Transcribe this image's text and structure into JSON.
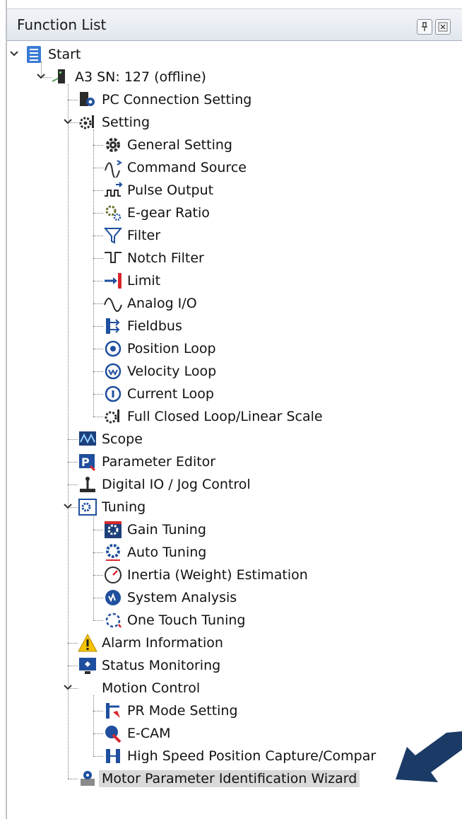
{
  "panel": {
    "title": "Function List"
  },
  "tree": {
    "root": "Start",
    "device": "A3 SN: 127 (offline)",
    "pc_connection": "PC Connection Setting",
    "setting": {
      "label": "Setting",
      "items": [
        "General Setting",
        "Command Source",
        "Pulse Output",
        "E-gear Ratio",
        "Filter",
        "Notch Filter",
        "Limit",
        "Analog I/O",
        "Fieldbus",
        "Position Loop",
        "Velocity Loop",
        "Current Loop",
        "Full Closed Loop/Linear Scale"
      ]
    },
    "scope": "Scope",
    "parameter_editor": "Parameter Editor",
    "digital_io": "Digital IO / Jog Control",
    "tuning": {
      "label": "Tuning",
      "items": [
        "Gain Tuning",
        "Auto Tuning",
        "Inertia (Weight) Estimation",
        "System Analysis",
        "One Touch Tuning"
      ]
    },
    "alarm": "Alarm Information",
    "status": "Status Monitoring",
    "motion": {
      "label": "Motion Control",
      "items": [
        "PR Mode Setting",
        "E-CAM",
        "High Speed Position Capture/Compar"
      ]
    },
    "motor_wizard": "Motor Parameter Identification Wizard"
  },
  "icons": {
    "root": "list-icon",
    "device": "servo-drive-icon",
    "pc_connection": "pc-connection-icon",
    "setting": "settings-tools-icon",
    "setting_items": [
      "gear-icon",
      "command-source-icon",
      "pulse-output-icon",
      "egear-icon",
      "filter-funnel-icon",
      "notch-filter-icon",
      "limit-icon",
      "analog-wave-icon",
      "fieldbus-icon",
      "position-loop-icon",
      "velocity-loop-icon",
      "current-loop-icon",
      "full-closed-loop-icon"
    ],
    "scope": "scope-icon",
    "parameter_editor": "parameter-editor-icon",
    "digital_io": "joystick-icon",
    "tuning": "tuning-icon",
    "tuning_items": [
      "gain-tuning-icon",
      "auto-tuning-icon",
      "inertia-gauge-icon",
      "system-analysis-icon",
      "one-touch-tuning-icon"
    ],
    "alarm": "warning-icon",
    "status": "status-monitor-icon",
    "motion_items": [
      "pr-mode-icon",
      "ecam-icon",
      "capture-compare-icon"
    ],
    "motor_wizard": "motor-wizard-icon"
  },
  "selected_item": "Motor Parameter Identification Wizard",
  "colors": {
    "icon_blue": "#1f4f9e",
    "icon_dark": "#2b2b2b",
    "accent_red": "#d8262d",
    "arrow_navy": "#1c3a66",
    "selection_gray": "#d9d9d9"
  }
}
